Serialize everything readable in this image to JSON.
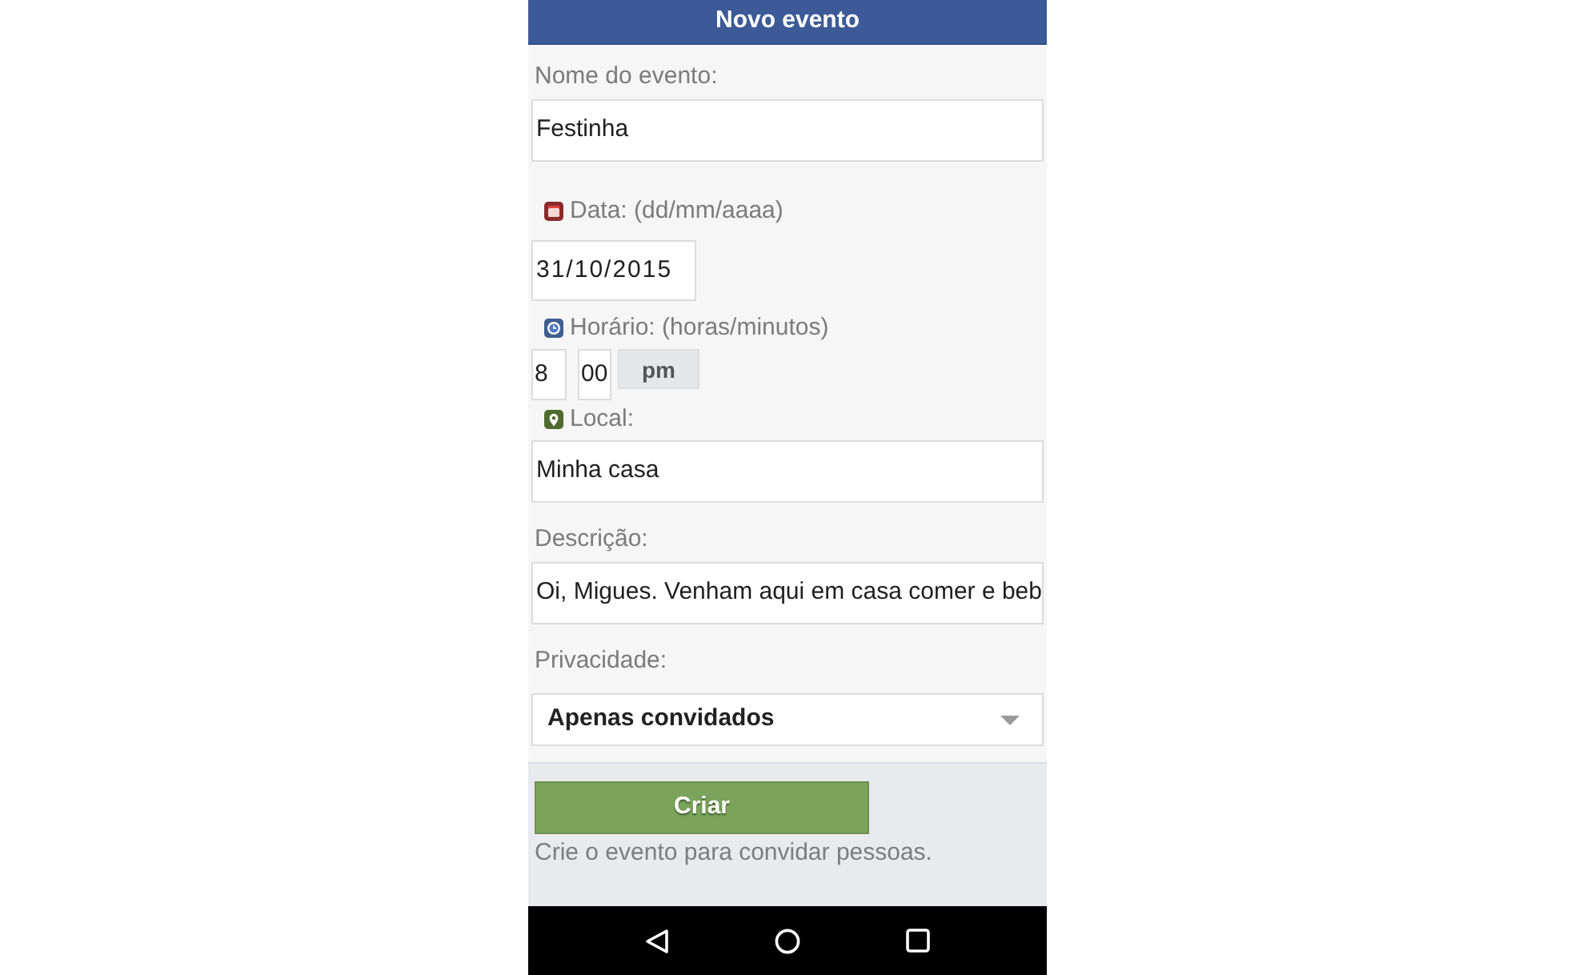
{
  "header": {
    "title": "Novo evento"
  },
  "form": {
    "fields": [
      {
        "kind": "text",
        "label": "Nome do evento:",
        "value": "Festinha"
      },
      {
        "kind": "date",
        "label": "Data: (dd/mm/aaaa)",
        "value": "31/10/2015"
      },
      {
        "kind": "time",
        "label": "Horário: (horas/minutos)",
        "hour": "8",
        "minute": "00",
        "period": "pm"
      },
      {
        "kind": "location",
        "label": "Local:",
        "value": "Minha casa"
      },
      {
        "kind": "text",
        "label": "Descrição:",
        "value": "Oi, Migues. Venham aqui em casa comer e beb"
      },
      {
        "kind": "select",
        "label": "Privacidade:",
        "value": "Apenas convidados"
      }
    ]
  },
  "footer": {
    "submit_button": "Criar",
    "hint": "Crie o evento para convidar pessoas."
  }
}
